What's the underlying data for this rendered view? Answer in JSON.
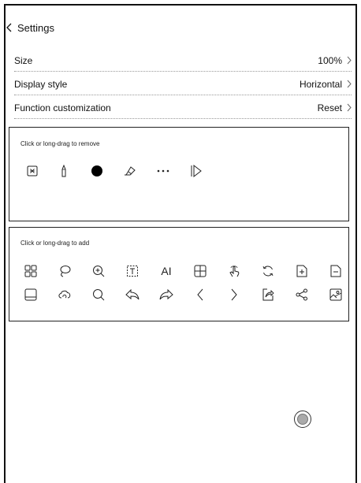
{
  "header": {
    "title": "Settings"
  },
  "settings": {
    "rows": [
      {
        "label": "Size",
        "value": "100%"
      },
      {
        "label": "Display style",
        "value": "Horizontal"
      },
      {
        "label": "Function customization",
        "value": "Reset"
      }
    ]
  },
  "remove_panel": {
    "label": "Click or long-drag to remove",
    "tools": [
      "scan-frame-icon",
      "pen-icon",
      "filled-dot-icon",
      "eraser-icon",
      "more-dots-icon",
      "collapse-arrow-icon"
    ]
  },
  "add_panel": {
    "label": "Click or long-drag to add",
    "row1": [
      "grid-icon",
      "lasso-icon",
      "zoom-in-icon",
      "text-box-icon",
      "ai-text-icon",
      "table-icon",
      "touch-icon",
      "refresh-icon",
      "add-page-icon",
      "remove-page-icon"
    ],
    "row2": [
      "save-icon",
      "cloud-sync-icon",
      "search-icon",
      "undo-icon",
      "redo-icon",
      "previous-page-icon",
      "next-page-icon",
      "export-icon",
      "share-icon",
      "image-icon"
    ],
    "ai_text": "AI"
  },
  "colors": {
    "border": "#111111",
    "divider": "#999999",
    "fab_fill": "#aaaaaa"
  }
}
